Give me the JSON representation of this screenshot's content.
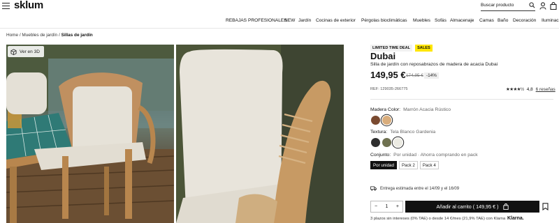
{
  "header": {
    "logo": "sklum",
    "search_placeholder": "Buscar producto"
  },
  "nav": {
    "items": [
      "REBAJAS",
      "PROFESIONALES",
      "NEW",
      "Jardín",
      "Cocinas de exterior",
      "Pérgolas bioclimáticas",
      "Muebles",
      "Sofás",
      "Almacenaje",
      "Camas",
      "Baño",
      "Decoración",
      "Iluminac"
    ]
  },
  "breadcrumb": {
    "home": "Home",
    "sep1": "/",
    "cat": "Muebles de jardín",
    "sep2": "/",
    "current": "Sillas de jardín"
  },
  "gallery": {
    "view3d_label": "Ver en 3D"
  },
  "product": {
    "badge_limited": "LIMITED TIME DEAL",
    "badge_sales": "SALES",
    "title": "Dubai",
    "subtitle": "Silla de jardín con reposabrazos de madera de acacia Dubai",
    "price": "149,95 €",
    "old_price": "174,95 €",
    "discount": "-14%",
    "ref": "REF: 129035-266775",
    "rating_stars": "★★★★½",
    "rating_value": "4,8",
    "reviews_link": "6 reseñas"
  },
  "options": {
    "wood_label": "Madera Color:",
    "wood_value": "Marrón Acacia Rústico",
    "wood_swatches": [
      {
        "color": "#7a4a30",
        "selected": false
      },
      {
        "color": "#d9ad7c",
        "selected": true
      }
    ],
    "fabric_label": "Textura:",
    "fabric_value": "Tela Blanco Gardenia",
    "fabric_swatches": [
      {
        "color": "#2e2e2e",
        "selected": false
      },
      {
        "color": "#6f7150",
        "selected": false
      },
      {
        "color": "#ecebe3",
        "selected": true
      }
    ],
    "set_label": "Conjunto:",
    "set_value": "Por unidad · Ahorra comprando en pack",
    "packs": [
      "Por unidad",
      "Pack 2",
      "Pack 4"
    ],
    "selected_pack": 0
  },
  "delivery": {
    "text": "Entrega estimada entre el 14/09 y el 16/09"
  },
  "cart": {
    "qty_minus": "−",
    "qty_value": "1",
    "qty_plus": "+",
    "add_label": "Añadir al carrito ( 149,95 € )"
  },
  "financing": {
    "text": "3 plazos sin intereses (0% TAE) o desde 14 €/mes (21,9% TAE) con Klarna",
    "brand": "Klarna."
  }
}
